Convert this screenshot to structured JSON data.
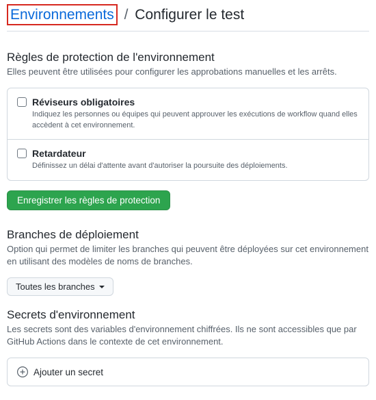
{
  "breadcrumb": {
    "link": "Environnements",
    "separator": "/",
    "current": "Configurer le test"
  },
  "protection": {
    "title": "Règles de protection de l'environnement",
    "desc": "Elles peuvent être utilisées pour configurer les approbations manuelles et les arrêts.",
    "rules": [
      {
        "label": "Réviseurs obligatoires",
        "desc": "Indiquez les personnes ou équipes qui peuvent approuver les exécutions de workflow quand elles accèdent à cet environnement."
      },
      {
        "label": "Retardateur",
        "desc": "Définissez un délai d'attente avant d'autoriser la poursuite des déploiements."
      }
    ],
    "save_button": "Enregistrer les règles de protection"
  },
  "branches": {
    "title": "Branches de déploiement",
    "desc": "Option qui permet de limiter les branches qui peuvent être déployées sur cet environnement en utilisant des modèles de noms de branches.",
    "dropdown": "Toutes les branches"
  },
  "secrets": {
    "title": "Secrets d'environnement",
    "desc": "Les secrets sont des variables d'environnement chiffrées. Ils ne sont accessibles que par GitHub Actions dans le contexte de cet environnement.",
    "add": "Ajouter un secret"
  }
}
